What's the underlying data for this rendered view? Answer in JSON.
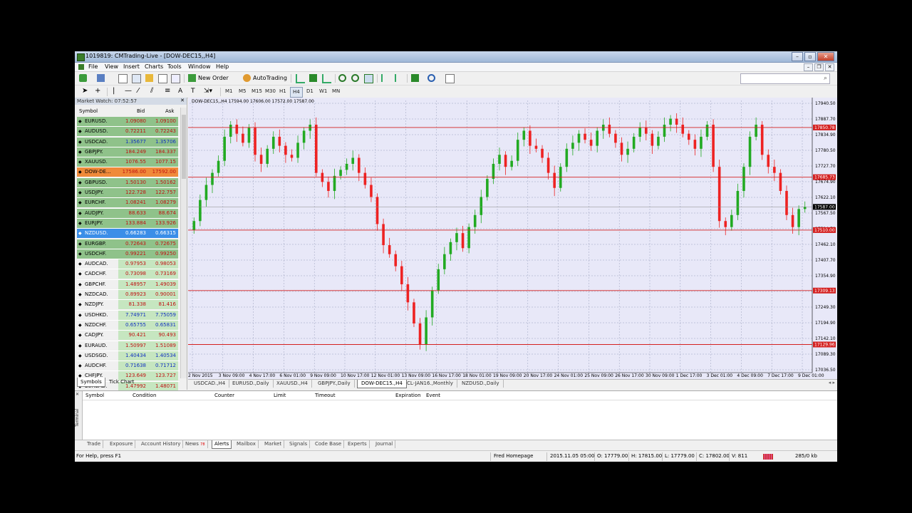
{
  "window": {
    "title": "1019819: CMTrading-Live - [DOW-DEC15,,H4]"
  },
  "menu": [
    "File",
    "View",
    "Insert",
    "Charts",
    "Tools",
    "Window",
    "Help"
  ],
  "toolbar": {
    "new_order": "New Order",
    "autotrading": "AutoTrading"
  },
  "timeframes": [
    "M1",
    "M5",
    "M15",
    "M30",
    "H1",
    "H4",
    "D1",
    "W1",
    "MN"
  ],
  "active_timeframe": "H4",
  "market_watch": {
    "title": "Market Watch: 07:52:57",
    "col_symbol": "Symbol",
    "col_bid": "Bid",
    "col_ask": "Ask",
    "rows": [
      {
        "symbol": "EURUSD.",
        "bid": "1.09080",
        "ask": "1.09100",
        "state": "down"
      },
      {
        "symbol": "AUDUSD.",
        "bid": "0.72211",
        "ask": "0.72243",
        "state": "down"
      },
      {
        "symbol": "USDCAD.",
        "bid": "1.35677",
        "ask": "1.35706",
        "state": "up"
      },
      {
        "symbol": "GBPJPY.",
        "bid": "184.249",
        "ask": "184.337",
        "state": "down"
      },
      {
        "symbol": "XAUUSD.",
        "bid": "1076.55",
        "ask": "1077.15",
        "state": "down"
      },
      {
        "symbol": "DOW-DE...",
        "bid": "17586.00",
        "ask": "17592.00",
        "state": "orange"
      },
      {
        "symbol": "GBPUSD.",
        "bid": "1.50130",
        "ask": "1.50162",
        "state": "down"
      },
      {
        "symbol": "USDJPY.",
        "bid": "122.728",
        "ask": "122.757",
        "state": "down"
      },
      {
        "symbol": "EURCHF.",
        "bid": "1.08241",
        "ask": "1.08279",
        "state": "down"
      },
      {
        "symbol": "AUDJPY.",
        "bid": "88.633",
        "ask": "88.674",
        "state": "down"
      },
      {
        "symbol": "EURJPY.",
        "bid": "133.884",
        "ask": "133.926",
        "state": "down"
      },
      {
        "symbol": "NZDUSD.",
        "bid": "0.66283",
        "ask": "0.66315",
        "state": "selected"
      },
      {
        "symbol": "EURGBP.",
        "bid": "0.72643",
        "ask": "0.72675",
        "state": "down"
      },
      {
        "symbol": "USDCHF.",
        "bid": "0.99221",
        "ask": "0.99250",
        "state": "down"
      },
      {
        "symbol": "AUDCAD.",
        "bid": "0.97953",
        "ask": "0.98053",
        "state": "neutral"
      },
      {
        "symbol": "CADCHF.",
        "bid": "0.73098",
        "ask": "0.73169",
        "state": "neutral"
      },
      {
        "symbol": "GBPCHF.",
        "bid": "1.48957",
        "ask": "1.49039",
        "state": "neutral"
      },
      {
        "symbol": "NZDCAD.",
        "bid": "0.89923",
        "ask": "0.90001",
        "state": "neutral"
      },
      {
        "symbol": "NZDJPY.",
        "bid": "81.338",
        "ask": "81.416",
        "state": "neutral"
      },
      {
        "symbol": "USDHKD.",
        "bid": "7.74971",
        "ask": "7.75059",
        "state": "neutral-up"
      },
      {
        "symbol": "NZDCHF.",
        "bid": "0.65755",
        "ask": "0.65831",
        "state": "neutral-up"
      },
      {
        "symbol": "CADJPY.",
        "bid": "90.421",
        "ask": "90.493",
        "state": "neutral"
      },
      {
        "symbol": "EURAUD.",
        "bid": "1.50997",
        "ask": "1.51089",
        "state": "neutral"
      },
      {
        "symbol": "USDSGD.",
        "bid": "1.40434",
        "ask": "1.40534",
        "state": "neutral-up"
      },
      {
        "symbol": "AUDCHF.",
        "bid": "0.71638",
        "ask": "0.71712",
        "state": "neutral-up"
      },
      {
        "symbol": "CHFJPY.",
        "bid": "123.649",
        "ask": "123.727",
        "state": "neutral"
      },
      {
        "symbol": "EURCAD.",
        "bid": "1.47992",
        "ask": "1.48071",
        "state": "neutral"
      }
    ],
    "tabs": [
      "Symbols",
      "Tick Chart"
    ]
  },
  "chart_data": {
    "type": "candlestick",
    "title": "DOW-DEC15,,H4  17594.00 17606.00 17572.00 17587.00",
    "y_ticks": [
      "17940.50",
      "17887.70",
      "17834.90",
      "17780.50",
      "17727.70",
      "17674.90",
      "17622.10",
      "17567.50",
      "17514.70",
      "17462.10",
      "17407.70",
      "17354.90",
      "17302.10",
      "17249.30",
      "17194.90",
      "17142.10",
      "17089.30",
      "17036.50"
    ],
    "x_ticks": [
      "2 Nov 2015",
      "3 Nov 09:00",
      "4 Nov 17:00",
      "6 Nov 01:00",
      "9 Nov 09:00",
      "10 Nov 17:00",
      "12 Nov 01:00",
      "13 Nov 09:00",
      "16 Nov 17:00",
      "18 Nov 01:00",
      "19 Nov 09:00",
      "20 Nov 17:00",
      "24 Nov 01:00",
      "25 Nov 09:00",
      "26 Nov 17:00",
      "30 Nov 09:00",
      "1 Dec 17:00",
      "3 Dec 01:00",
      "4 Dec 09:00",
      "7 Dec 17:00",
      "9 Dec 01:00"
    ],
    "ylim": [
      17036.5,
      17940.5
    ],
    "levels": [
      {
        "value": 17850.78,
        "label": "17850.78"
      },
      {
        "value": 17685.73,
        "label": "17685.73"
      },
      {
        "value": 17510.0,
        "label": "17510.00"
      },
      {
        "value": 17309.13,
        "label": "17309.13"
      },
      {
        "value": 17129.96,
        "label": "17129.96"
      }
    ],
    "current_price": {
      "value": 17587.0,
      "label": "17587.00"
    },
    "closes": [
      17540,
      17610,
      17660,
      17700,
      17740,
      17820,
      17860,
      17830,
      17800,
      17850,
      17760,
      17730,
      17780,
      17820,
      17790,
      17760,
      17750,
      17800,
      17840,
      17860,
      17700,
      17670,
      17640,
      17690,
      17710,
      17730,
      17750,
      17700,
      17660,
      17620,
      17530,
      17460,
      17430,
      17390,
      17330,
      17270,
      17200,
      17130,
      17220,
      17310,
      17380,
      17430,
      17470,
      17500,
      17450,
      17520,
      17560,
      17620,
      17680,
      17730,
      17760,
      17720,
      17740,
      17810,
      17840,
      17790,
      17780,
      17750,
      17700,
      17650,
      17720,
      17780,
      17800,
      17830,
      17810,
      17790,
      17840,
      17860,
      17830,
      17800,
      17760,
      17780,
      17820,
      17850,
      17830,
      17790,
      17820,
      17860,
      17880,
      17860,
      17830,
      17810,
      17780,
      17820,
      17860,
      17720,
      17540,
      17520,
      17560,
      17640,
      17720,
      17820,
      17860,
      17760,
      17720,
      17700,
      17640,
      17560,
      17520,
      17580,
      17587
    ]
  },
  "chart_tabs": [
    "USDCAD.,H4",
    "EURUSD.,Daily",
    "XAUUSD.,H4",
    "GBPJPY.,Daily",
    "DOW-DEC15.,H4",
    "CL-JAN16.,Monthly",
    "NZDUSD.,Daily"
  ],
  "active_chart_tab": "DOW-DEC15.,H4",
  "terminal": {
    "side_label": "Terminal",
    "columns": [
      "Symbol",
      "Condition",
      "Counter",
      "Limit",
      "Timeout",
      "Expiration",
      "Event"
    ],
    "tabs": [
      "Trade",
      "Exposure",
      "Account History",
      "News",
      "Alerts",
      "Mailbox",
      "Market",
      "Signals",
      "Code Base",
      "Experts",
      "Journal"
    ],
    "news_badge": "78",
    "active_tab": "Alerts"
  },
  "status": {
    "help": "For Help, press F1",
    "profile": "Fred Homepage",
    "datetime": "2015.11.05 05:00",
    "open": "O: 17779.00",
    "high": "H: 17815.00",
    "low": "L: 17779.00",
    "close": "C: 17802.00",
    "volume": "V: 811",
    "traffic": "285/0 kb"
  },
  "colors": {
    "bull": "#22aa22",
    "bear": "#ee2222",
    "chart_bg": "#e8e8f8",
    "level_line": "#d42020",
    "mw_down_row": "#8fc28a",
    "mw_orange": "#f08a3a",
    "mw_selected": "#3b8ee8"
  }
}
